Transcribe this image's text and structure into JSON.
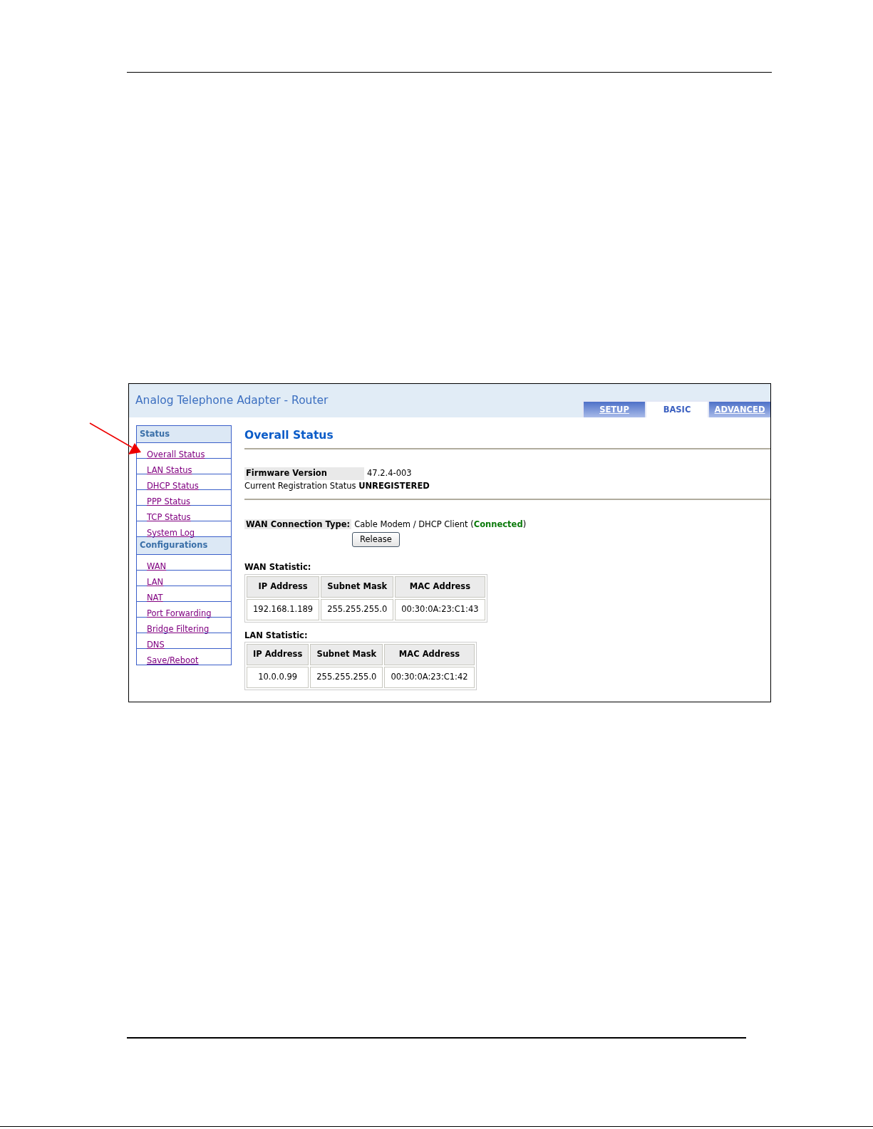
{
  "app": {
    "title": "Analog Telephone Adapter - Router",
    "tabs": [
      {
        "label": "SETUP",
        "selected": false
      },
      {
        "label": "BASIC",
        "selected": true
      },
      {
        "label": "ADVANCED",
        "selected": false
      }
    ],
    "sidebar": {
      "sections": [
        {
          "title": "Status",
          "items": [
            "Overall Status",
            "LAN Status",
            "DHCP Status",
            "PPP Status",
            "TCP Status",
            "System Log"
          ]
        },
        {
          "title": "Configurations",
          "items": [
            "WAN",
            "LAN",
            "NAT",
            "Port Forwarding",
            "Bridge Filtering",
            "DNS",
            "Save/Reboot"
          ]
        }
      ]
    },
    "main": {
      "heading": "Overall Status",
      "firmware": {
        "label": "Firmware Version",
        "value": "47.2.4-003"
      },
      "registration": "Current Registration Status **UNREGISTERED**",
      "wan_connection": {
        "label": "WAN Connection Type:",
        "value": "Cable Modem / DHCP Client (**Connected**)"
      },
      "button": "Release",
      "tables": [
        {
          "title": "WAN Statistic:",
          "columns": [
            "IP Address",
            "Subnet Mask",
            "MAC Address"
          ],
          "rows": [
            [
              "192.168.1.189",
              "255.255.255.0",
              "00:30:0A:23:C1:43"
            ]
          ]
        },
        {
          "title": "LAN Statistic:",
          "columns": [
            "IP Address",
            "Subnet Mask",
            "MAC Address"
          ],
          "rows": [
            [
              "10.0.0.99",
              "255.255.255.0",
              "00:30:0A:23:C1:42"
            ]
          ]
        }
      ]
    }
  }
}
